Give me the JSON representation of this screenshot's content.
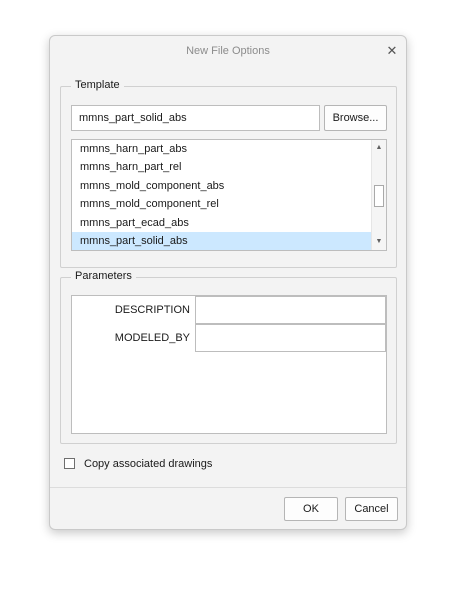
{
  "dialog": {
    "title": "New File Options",
    "close_glyph": "✕"
  },
  "template": {
    "group_label": "Template",
    "input_value": "mmns_part_solid_abs",
    "browse_label": "Browse...",
    "items": [
      {
        "label": "mmns_harn_part_abs",
        "selected": false
      },
      {
        "label": "mmns_harn_part_rel",
        "selected": false
      },
      {
        "label": "mmns_mold_component_abs",
        "selected": false
      },
      {
        "label": "mmns_mold_component_rel",
        "selected": false
      },
      {
        "label": "mmns_part_ecad_abs",
        "selected": false
      },
      {
        "label": "mmns_part_solid_abs",
        "selected": true
      }
    ],
    "scroll_up_glyph": "▲",
    "scroll_down_glyph": "▼"
  },
  "parameters": {
    "group_label": "Parameters",
    "rows": [
      {
        "name": "DESCRIPTION",
        "value": ""
      },
      {
        "name": "MODELED_BY",
        "value": ""
      }
    ]
  },
  "copy_drawings": {
    "label": "Copy associated drawings",
    "checked": false
  },
  "buttons": {
    "ok": "OK",
    "cancel": "Cancel"
  },
  "colors": {
    "selection": "#cce8ff",
    "dialog_bg": "#f3f3f3"
  },
  "icons": {
    "close": "close-icon",
    "scroll_up": "chevron-up-icon",
    "scroll_down": "chevron-down-icon"
  }
}
